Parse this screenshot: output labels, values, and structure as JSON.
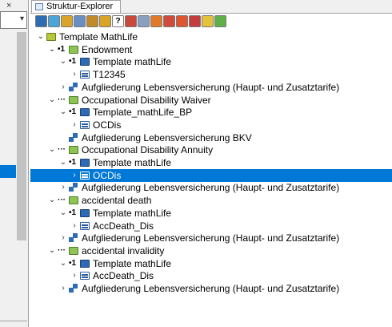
{
  "left_panel": {
    "close_glyph": "×",
    "dropdown_arrow": "▾"
  },
  "window": {
    "tab_title": "Struktur-Explorer"
  },
  "toolbar": [
    {
      "name": "toolbar-btn-1-icon",
      "color": "#2f6bb4",
      "glyph": ""
    },
    {
      "name": "toolbar-btn-2-icon",
      "color": "#4aa6d8",
      "glyph": ""
    },
    {
      "name": "toolbar-btn-3-icon",
      "color": "#d9a428",
      "glyph": ""
    },
    {
      "name": "toolbar-btn-4-icon",
      "color": "#6a8fc2",
      "glyph": ""
    },
    {
      "name": "toolbar-btn-5-icon",
      "color": "#c28a2a",
      "glyph": ""
    },
    {
      "name": "toolbar-btn-6-icon",
      "color": "#d9a428",
      "glyph": ""
    },
    {
      "name": "toolbar-help-icon",
      "color": "#ffffff",
      "glyph": "?"
    },
    {
      "name": "toolbar-btn-8-icon",
      "color": "#c74a3a",
      "glyph": ""
    },
    {
      "name": "toolbar-btn-9-icon",
      "color": "#8aa0c0",
      "glyph": ""
    },
    {
      "name": "toolbar-btn-10-icon",
      "color": "#e07a2a",
      "glyph": ""
    },
    {
      "name": "toolbar-btn-11-icon",
      "color": "#d04b3b",
      "glyph": ""
    },
    {
      "name": "toolbar-btn-12-icon",
      "color": "#e0552f",
      "glyph": ""
    },
    {
      "name": "toolbar-btn-13-icon",
      "color": "#c43c3c",
      "glyph": ""
    },
    {
      "name": "toolbar-btn-14-icon",
      "color": "#e6c23a",
      "glyph": ""
    },
    {
      "name": "toolbar-btn-15-icon",
      "color": "#5fb04a",
      "glyph": ""
    }
  ],
  "tree": [
    {
      "indent": 0,
      "chevron": "⌄",
      "marker": "",
      "icon": "yellow-green",
      "label": "Template MathLife",
      "selected": false
    },
    {
      "indent": 1,
      "chevron": "⌄",
      "marker": "•1",
      "icon": "green",
      "label": "Endowment",
      "selected": false
    },
    {
      "indent": 2,
      "chevron": "⌄",
      "marker": "•1",
      "icon": "blue",
      "label": "Template mathLife",
      "selected": false
    },
    {
      "indent": 3,
      "chevron": "›",
      "marker": "",
      "icon": "doc",
      "label": "T12345",
      "selected": false
    },
    {
      "indent": 2,
      "chevron": "›",
      "marker": "",
      "icon": "split",
      "label": "Aufgliederung Lebensversicherung (Haupt- und Zusatztarife)",
      "selected": false
    },
    {
      "indent": 1,
      "chevron": "⌄",
      "marker": "···",
      "icon": "green",
      "label": "Occupational Disability Waiver",
      "selected": false
    },
    {
      "indent": 2,
      "chevron": "⌄",
      "marker": "•1",
      "icon": "blue",
      "label": "Template_mathLife_BP",
      "selected": false
    },
    {
      "indent": 3,
      "chevron": "›",
      "marker": "",
      "icon": "doc",
      "label": "OCDis",
      "selected": false
    },
    {
      "indent": 2,
      "chevron": "",
      "marker": "",
      "icon": "split",
      "label": "Aufgliederung Lebensversicherung BKV",
      "selected": false
    },
    {
      "indent": 1,
      "chevron": "⌄",
      "marker": "···",
      "icon": "green",
      "label": "Occupational Disability Annuity",
      "selected": false
    },
    {
      "indent": 2,
      "chevron": "⌄",
      "marker": "•1",
      "icon": "blue",
      "label": "Template mathLife",
      "selected": false
    },
    {
      "indent": 3,
      "chevron": "›",
      "marker": "",
      "icon": "doc",
      "label": "OCDis",
      "selected": true
    },
    {
      "indent": 2,
      "chevron": "›",
      "marker": "",
      "icon": "split",
      "label": "Aufgliederung Lebensversicherung (Haupt- und Zusatztarife)",
      "selected": false
    },
    {
      "indent": 1,
      "chevron": "⌄",
      "marker": "···",
      "icon": "green",
      "label": "accidental death",
      "selected": false
    },
    {
      "indent": 2,
      "chevron": "⌄",
      "marker": "•1",
      "icon": "blue",
      "label": "Template mathLife",
      "selected": false
    },
    {
      "indent": 3,
      "chevron": "›",
      "marker": "",
      "icon": "doc",
      "label": "AccDeath_Dis",
      "selected": false
    },
    {
      "indent": 2,
      "chevron": "›",
      "marker": "",
      "icon": "split",
      "label": "Aufgliederung Lebensversicherung (Haupt- und Zusatztarife)",
      "selected": false
    },
    {
      "indent": 1,
      "chevron": "⌄",
      "marker": "···",
      "icon": "green",
      "label": "accidental invalidity",
      "selected": false
    },
    {
      "indent": 2,
      "chevron": "⌄",
      "marker": "•1",
      "icon": "blue",
      "label": "Template mathLife",
      "selected": false
    },
    {
      "indent": 3,
      "chevron": "›",
      "marker": "",
      "icon": "doc",
      "label": "AccDeath_Dis",
      "selected": false
    },
    {
      "indent": 2,
      "chevron": "›",
      "marker": "",
      "icon": "split",
      "label": "Aufgliederung Lebensversicherung (Haupt- und Zusatztarife)",
      "selected": false
    }
  ]
}
